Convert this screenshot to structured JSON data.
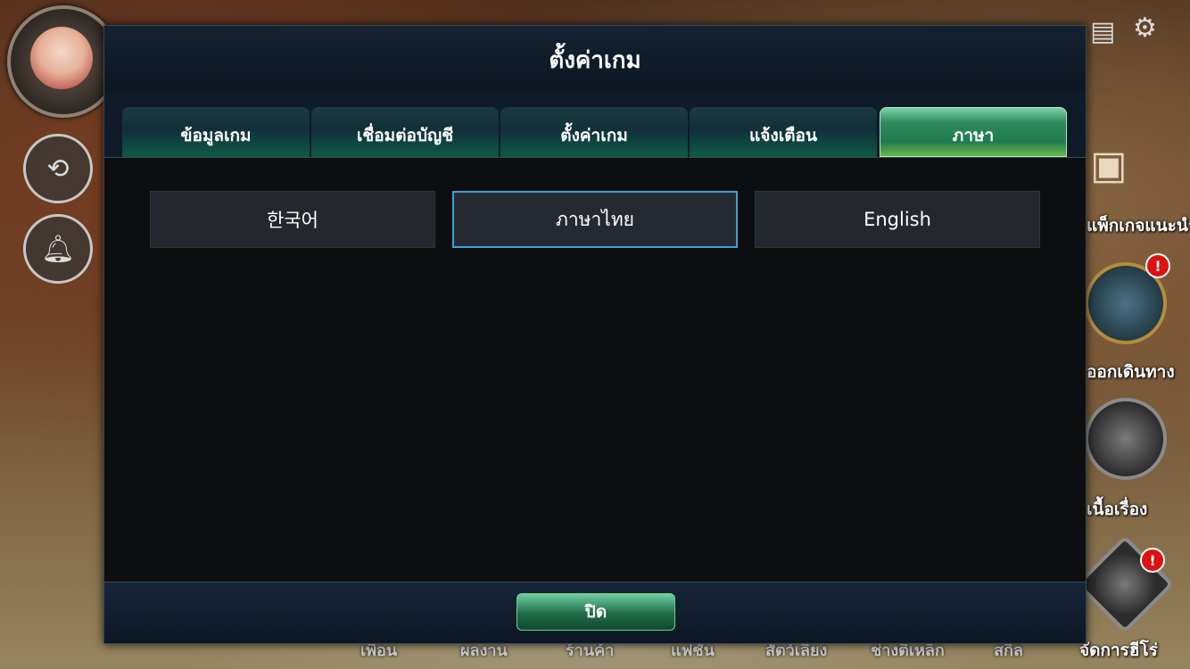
{
  "dialog": {
    "title": "ตั้งค่าเกม",
    "tabs": [
      {
        "label": "ข้อมูลเกม",
        "active": false
      },
      {
        "label": "เชื่อมต่อบัญชี",
        "active": false
      },
      {
        "label": "ตั้งค่าเกม",
        "active": false
      },
      {
        "label": "แจ้งเตือน",
        "active": false
      },
      {
        "label": "ภาษา",
        "active": true
      }
    ],
    "languages": [
      {
        "label": "한국어",
        "selected": false
      },
      {
        "label": "ภาษาไทย",
        "selected": true
      },
      {
        "label": "English",
        "selected": false
      }
    ],
    "close_label": "ปิด"
  },
  "right_menu": {
    "labels": [
      "แพ็กเกจแนะนำ",
      "ออกเดินทาง",
      "เนื้อเรื่อง",
      "จัดการฮีโร่"
    ],
    "alert": "!"
  },
  "bottom_nav": [
    "เพื่อน",
    "ผลงาน",
    "ร้านค้า",
    "แฟชั่น",
    "สัตว์เลี้ยง",
    "ช่างตีเหล็ก",
    "สกิล"
  ],
  "colors": {
    "accent_green": "#1f7a4e",
    "selected_border": "#3aa3d7",
    "alert_red": "#d11111"
  }
}
